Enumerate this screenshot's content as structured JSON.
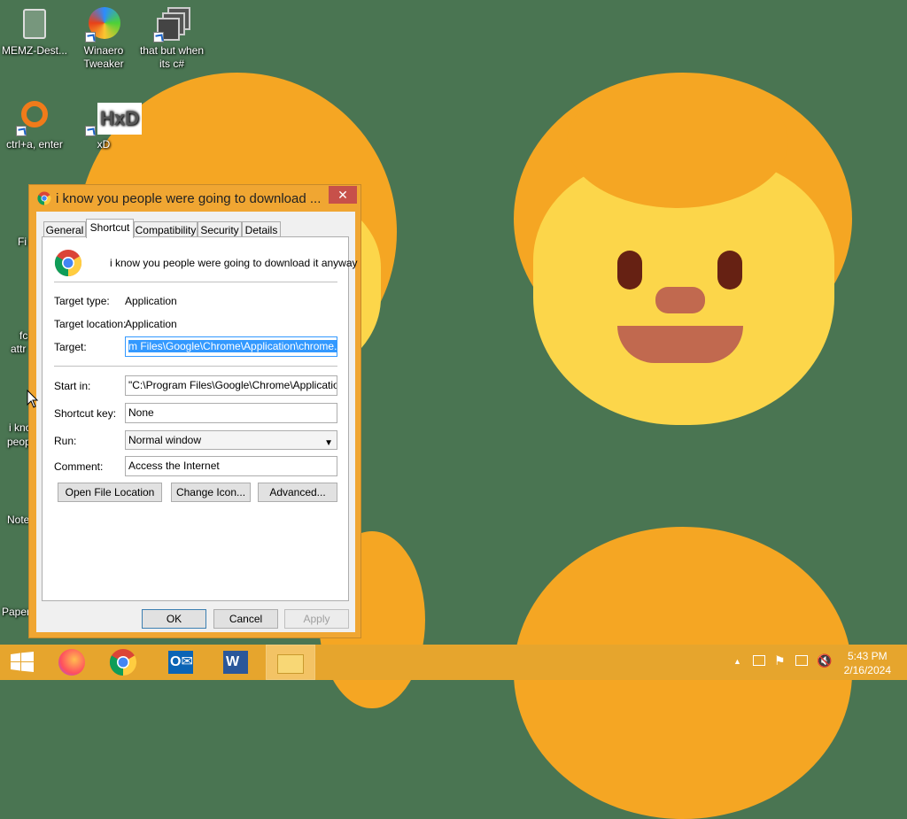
{
  "desktop_icons": [
    {
      "label": "MEMZ-Dest..."
    },
    {
      "label": "Winaero Tweaker"
    },
    {
      "label": "that but when its c#"
    },
    {
      "label": "ctrl+a, enter"
    },
    {
      "label": "xD"
    }
  ],
  "edge_labels": [
    "Fi",
    "fc",
    "attr",
    "i kno",
    "peop",
    "Note",
    "Paper"
  ],
  "dialog": {
    "title": "i know you people were going to download ...",
    "close": "✕",
    "tabs": [
      "General",
      "Shortcut",
      "Compatibility",
      "Security",
      "Details"
    ],
    "active_tab": "Shortcut",
    "name": "i know you people were going to download it anyway",
    "target_type_label": "Target type:",
    "target_type": "Application",
    "target_location_label": "Target location:",
    "target_location": "Application",
    "target_label": "Target:",
    "target_value": "m Files\\Google\\Chrome\\Application\\chrome.exe\"",
    "start_in_label": "Start in:",
    "start_in_value": "\"C:\\Program Files\\Google\\Chrome\\Application\"",
    "shortcut_key_label": "Shortcut key:",
    "shortcut_key_value": "None",
    "run_label": "Run:",
    "run_value": "Normal window",
    "comment_label": "Comment:",
    "comment_value": "Access the Internet",
    "open_location": "Open File Location",
    "change_icon": "Change Icon...",
    "advanced": "Advanced...",
    "ok": "OK",
    "cancel": "Cancel",
    "apply": "Apply"
  },
  "taskbar": {
    "apps": [
      "start",
      "firefox",
      "chrome",
      "outlook",
      "word",
      "file-explorer"
    ],
    "time": "5:43 PM",
    "date": "2/16/2024"
  },
  "colors": {
    "desktop": "#4a7552",
    "window_frame": "#f0a632",
    "taskbar": "#e6a52d",
    "close": "#c7504a"
  }
}
